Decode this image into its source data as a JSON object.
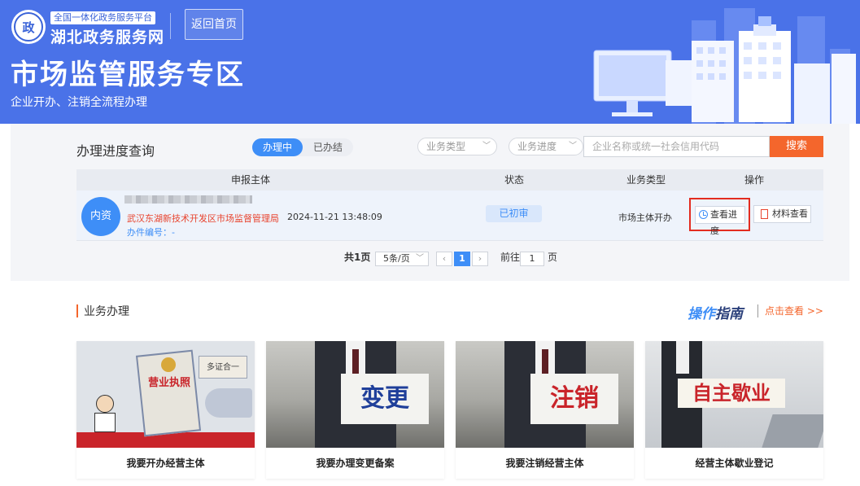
{
  "header": {
    "logo_top": "全国一体化政务服务平台",
    "logo_main": "湖北政务服务网",
    "home_button": "返回首页",
    "title": "市场监管服务专区",
    "subtitle": "企业开办、注销全流程办理"
  },
  "progress": {
    "title": "办理进度查询",
    "tabs": [
      "办理中",
      "已办结"
    ],
    "active_tab": "办理中",
    "filters": {
      "business_type": "业务类型",
      "business_progress": "业务进度"
    },
    "search": {
      "placeholder": "企业名称或统一社会信用代码",
      "button": "搜索"
    },
    "columns": [
      "申报主体",
      "状态",
      "业务类型",
      "操作"
    ],
    "rows": [
      {
        "avatar": "内资",
        "org": "武汉东湖新技术开发区市场监督管理局",
        "time": "2024-11-21 13:48:09",
        "case_no": "办件编号：-",
        "status": "已初审",
        "business_type": "市场主体开办",
        "action_progress": "查看进度",
        "action_material": "材料查看"
      }
    ],
    "pager": {
      "total": "共1页",
      "page_size": "5条/页",
      "current_page": "1",
      "goto_label": "前往",
      "goto_value": "1",
      "page_suffix": "页",
      "prev": "‹",
      "next": "›"
    }
  },
  "business": {
    "title": "业务办理",
    "guide_logo_a": "操作",
    "guide_logo_b": "指南",
    "guide_link": "点击查看 >>",
    "cards": [
      {
        "label": "我要开办经营主体",
        "sign": "营业执照"
      },
      {
        "label": "我要办理变更备案",
        "sign": "变更"
      },
      {
        "label": "我要注销经营主体",
        "sign": "注销"
      },
      {
        "label": "经营主体歇业登记",
        "sign": "自主歇业"
      }
    ]
  },
  "colors": {
    "header_blue": "#4a72e8",
    "accent_orange": "#f4662c",
    "link_blue": "#3e8ef7",
    "highlight_red": "#e32c20"
  }
}
